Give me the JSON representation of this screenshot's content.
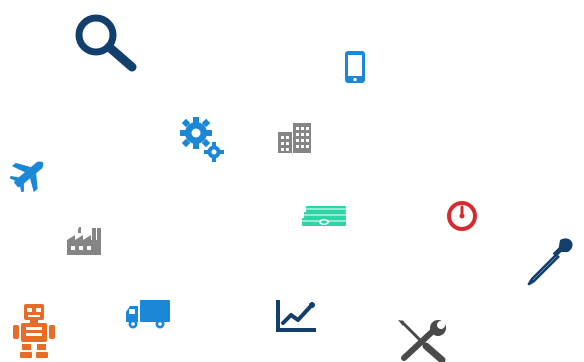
{
  "icons": [
    {
      "name": "magnifying-glass-icon",
      "color": "#123f6b"
    },
    {
      "name": "smartphone-icon",
      "color": "#1a88d6"
    },
    {
      "name": "gears-icon",
      "color": "#1a88d6"
    },
    {
      "name": "buildings-icon",
      "color": "#858585"
    },
    {
      "name": "airplane-icon",
      "color": "#1a88d6"
    },
    {
      "name": "money-stack-icon",
      "color": "#2ed3a6"
    },
    {
      "name": "speedometer-icon",
      "color": "#d72a2e"
    },
    {
      "name": "factory-icon",
      "color": "#858585"
    },
    {
      "name": "eyedropper-icon",
      "color": "#123f6b"
    },
    {
      "name": "robot-icon",
      "color": "#e86c29"
    },
    {
      "name": "delivery-truck-icon",
      "color": "#1a88d6"
    },
    {
      "name": "line-chart-icon",
      "color": "#123f6b"
    },
    {
      "name": "wrench-screwdriver-icon",
      "color": "#4a4a4a"
    }
  ]
}
